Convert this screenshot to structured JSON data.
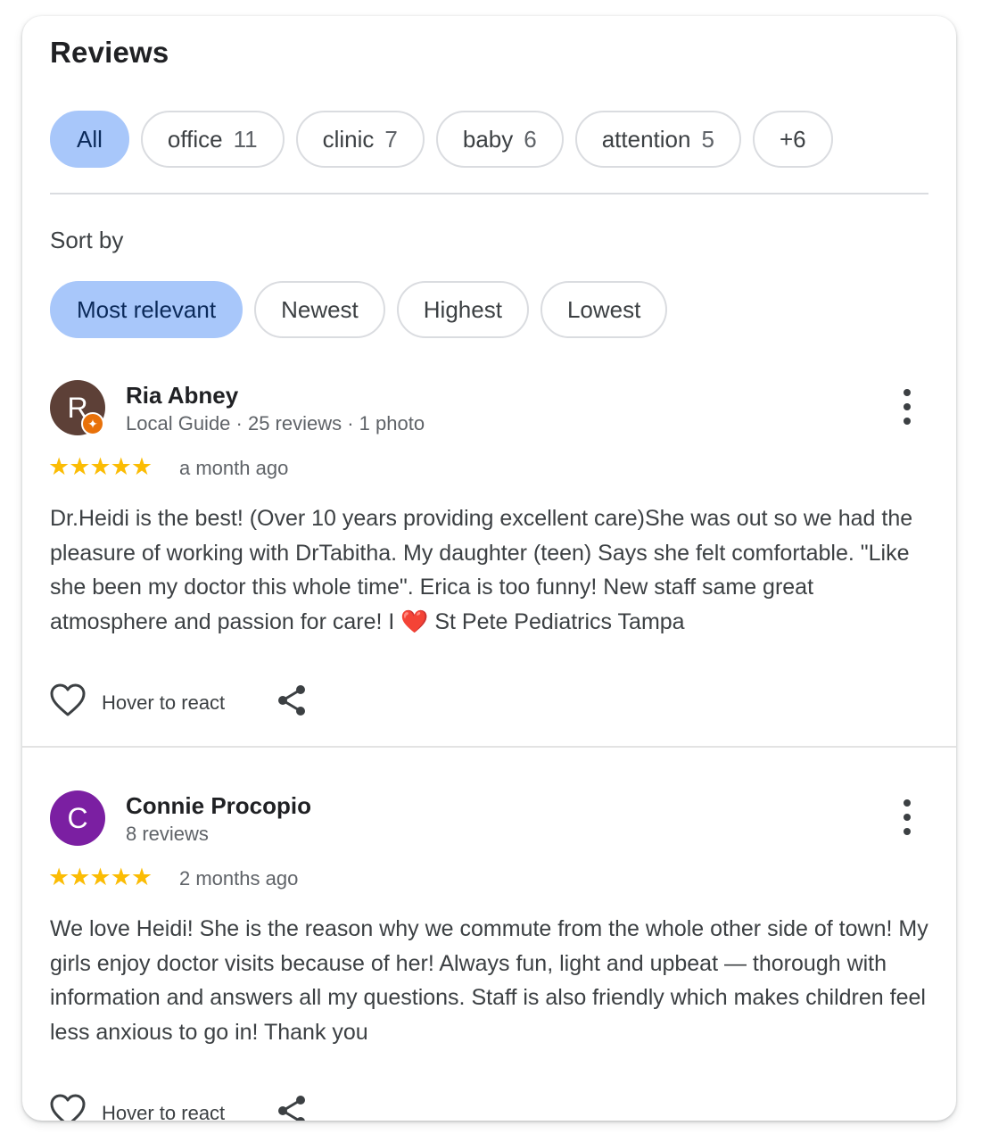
{
  "header": {
    "title": "Reviews"
  },
  "topic_chips": [
    {
      "label": "All",
      "count": "",
      "active": true
    },
    {
      "label": "office",
      "count": "11",
      "active": false
    },
    {
      "label": "clinic",
      "count": "7",
      "active": false
    },
    {
      "label": "baby",
      "count": "6",
      "active": false
    },
    {
      "label": "attention",
      "count": "5",
      "active": false
    },
    {
      "label": "+6",
      "count": "",
      "active": false
    }
  ],
  "sort": {
    "label": "Sort by",
    "options": [
      "Most relevant",
      "Newest",
      "Highest",
      "Lowest"
    ],
    "selected": "Most relevant"
  },
  "reviews": [
    {
      "initial": "R",
      "avatar_color": "#5d4037",
      "local_guide_badge": true,
      "name": "Ria Abney",
      "meta": "Local Guide · 25 reviews · 1 photo",
      "rating": 5,
      "stars": "★★★★★",
      "time": "a month ago",
      "text": "Dr.Heidi is the best! (Over 10 years providing excellent care)She was out so we had the pleasure of working with DrTabitha. My daughter (teen) Says she felt comfortable. \"Like she been my doctor this whole time\". Erica is too funny! New staff same great atmosphere and passion for care! I ❤️ St Pete Pediatrics Tampa",
      "react_label": "Hover to react"
    },
    {
      "initial": "C",
      "avatar_color": "#7b1fa2",
      "local_guide_badge": false,
      "name": "Connie Procopio",
      "meta": "8 reviews",
      "rating": 5,
      "stars": "★★★★★",
      "time": "2 months ago",
      "text": "We love Heidi! She is the reason why we commute from the whole other side of town! My girls enjoy doctor visits because of her! Always fun, light and upbeat — thorough with information and answers all my questions. Staff is also friendly which makes children feel less anxious to go in! Thank you",
      "react_label": "Hover to react"
    }
  ],
  "colors": {
    "active_chip": "#a8c7fa",
    "star": "#fbbc04",
    "badge": "#e8710a"
  }
}
